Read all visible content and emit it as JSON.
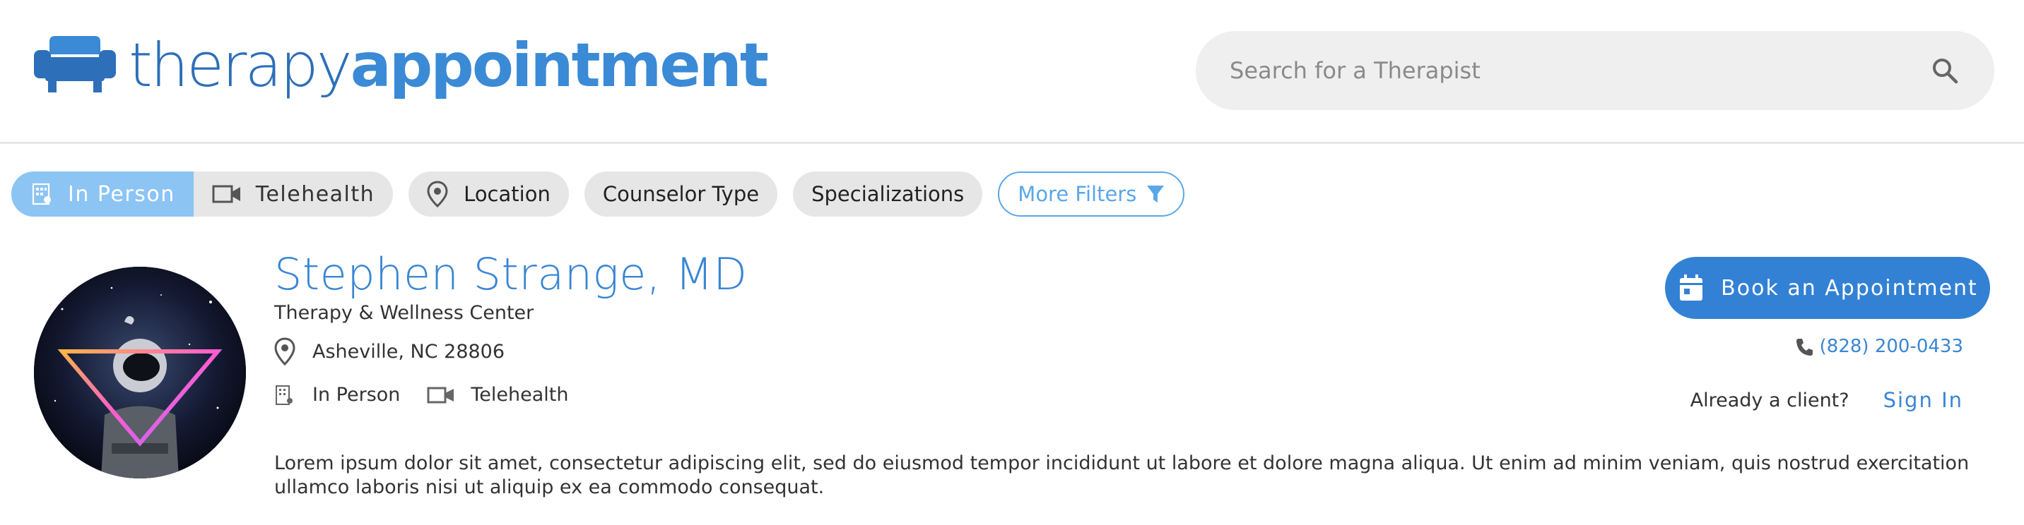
{
  "brand": {
    "logo_part1": "therapy",
    "logo_part2": "appointment",
    "logo_icon": "sofa-icon",
    "colors": {
      "dark_blue": "#2d6fb8",
      "blue": "#3a8ad6",
      "accent": "#3381d4",
      "light_blue": "#8cc4f4"
    }
  },
  "search": {
    "placeholder": "Search for a Therapist",
    "icon": "search-icon"
  },
  "filters": {
    "mode_toggle": [
      {
        "label": "In Person",
        "icon": "building-icon",
        "active": true
      },
      {
        "label": "Telehealth",
        "icon": "video-camera-icon",
        "active": false
      }
    ],
    "location": {
      "label": "Location",
      "icon": "map-pin-icon"
    },
    "counselor_type": {
      "label": "Counselor Type"
    },
    "specializations": {
      "label": "Specializations"
    },
    "more": {
      "label": "More Filters",
      "icon": "funnel-icon"
    }
  },
  "profile": {
    "name": "Stephen Strange, MD",
    "practice": "Therapy & Wellness Center",
    "location": "Asheville, NC 28806",
    "modes": {
      "in_person": "In Person",
      "telehealth": "Telehealth"
    },
    "description": "Lorem ipsum dolor sit amet, consectetur adipiscing elit, sed do eiusmod tempor incididunt ut labore et dolore magna aliqua. Ut enim ad minim veniam, quis nostrud exercitation ullamco laboris nisi ut aliquip ex ea commodo consequat."
  },
  "actions": {
    "book_label": "Book an Appointment",
    "phone": "(828) 200-0433",
    "client_question": "Already a client?",
    "sign_in": "Sign In"
  }
}
